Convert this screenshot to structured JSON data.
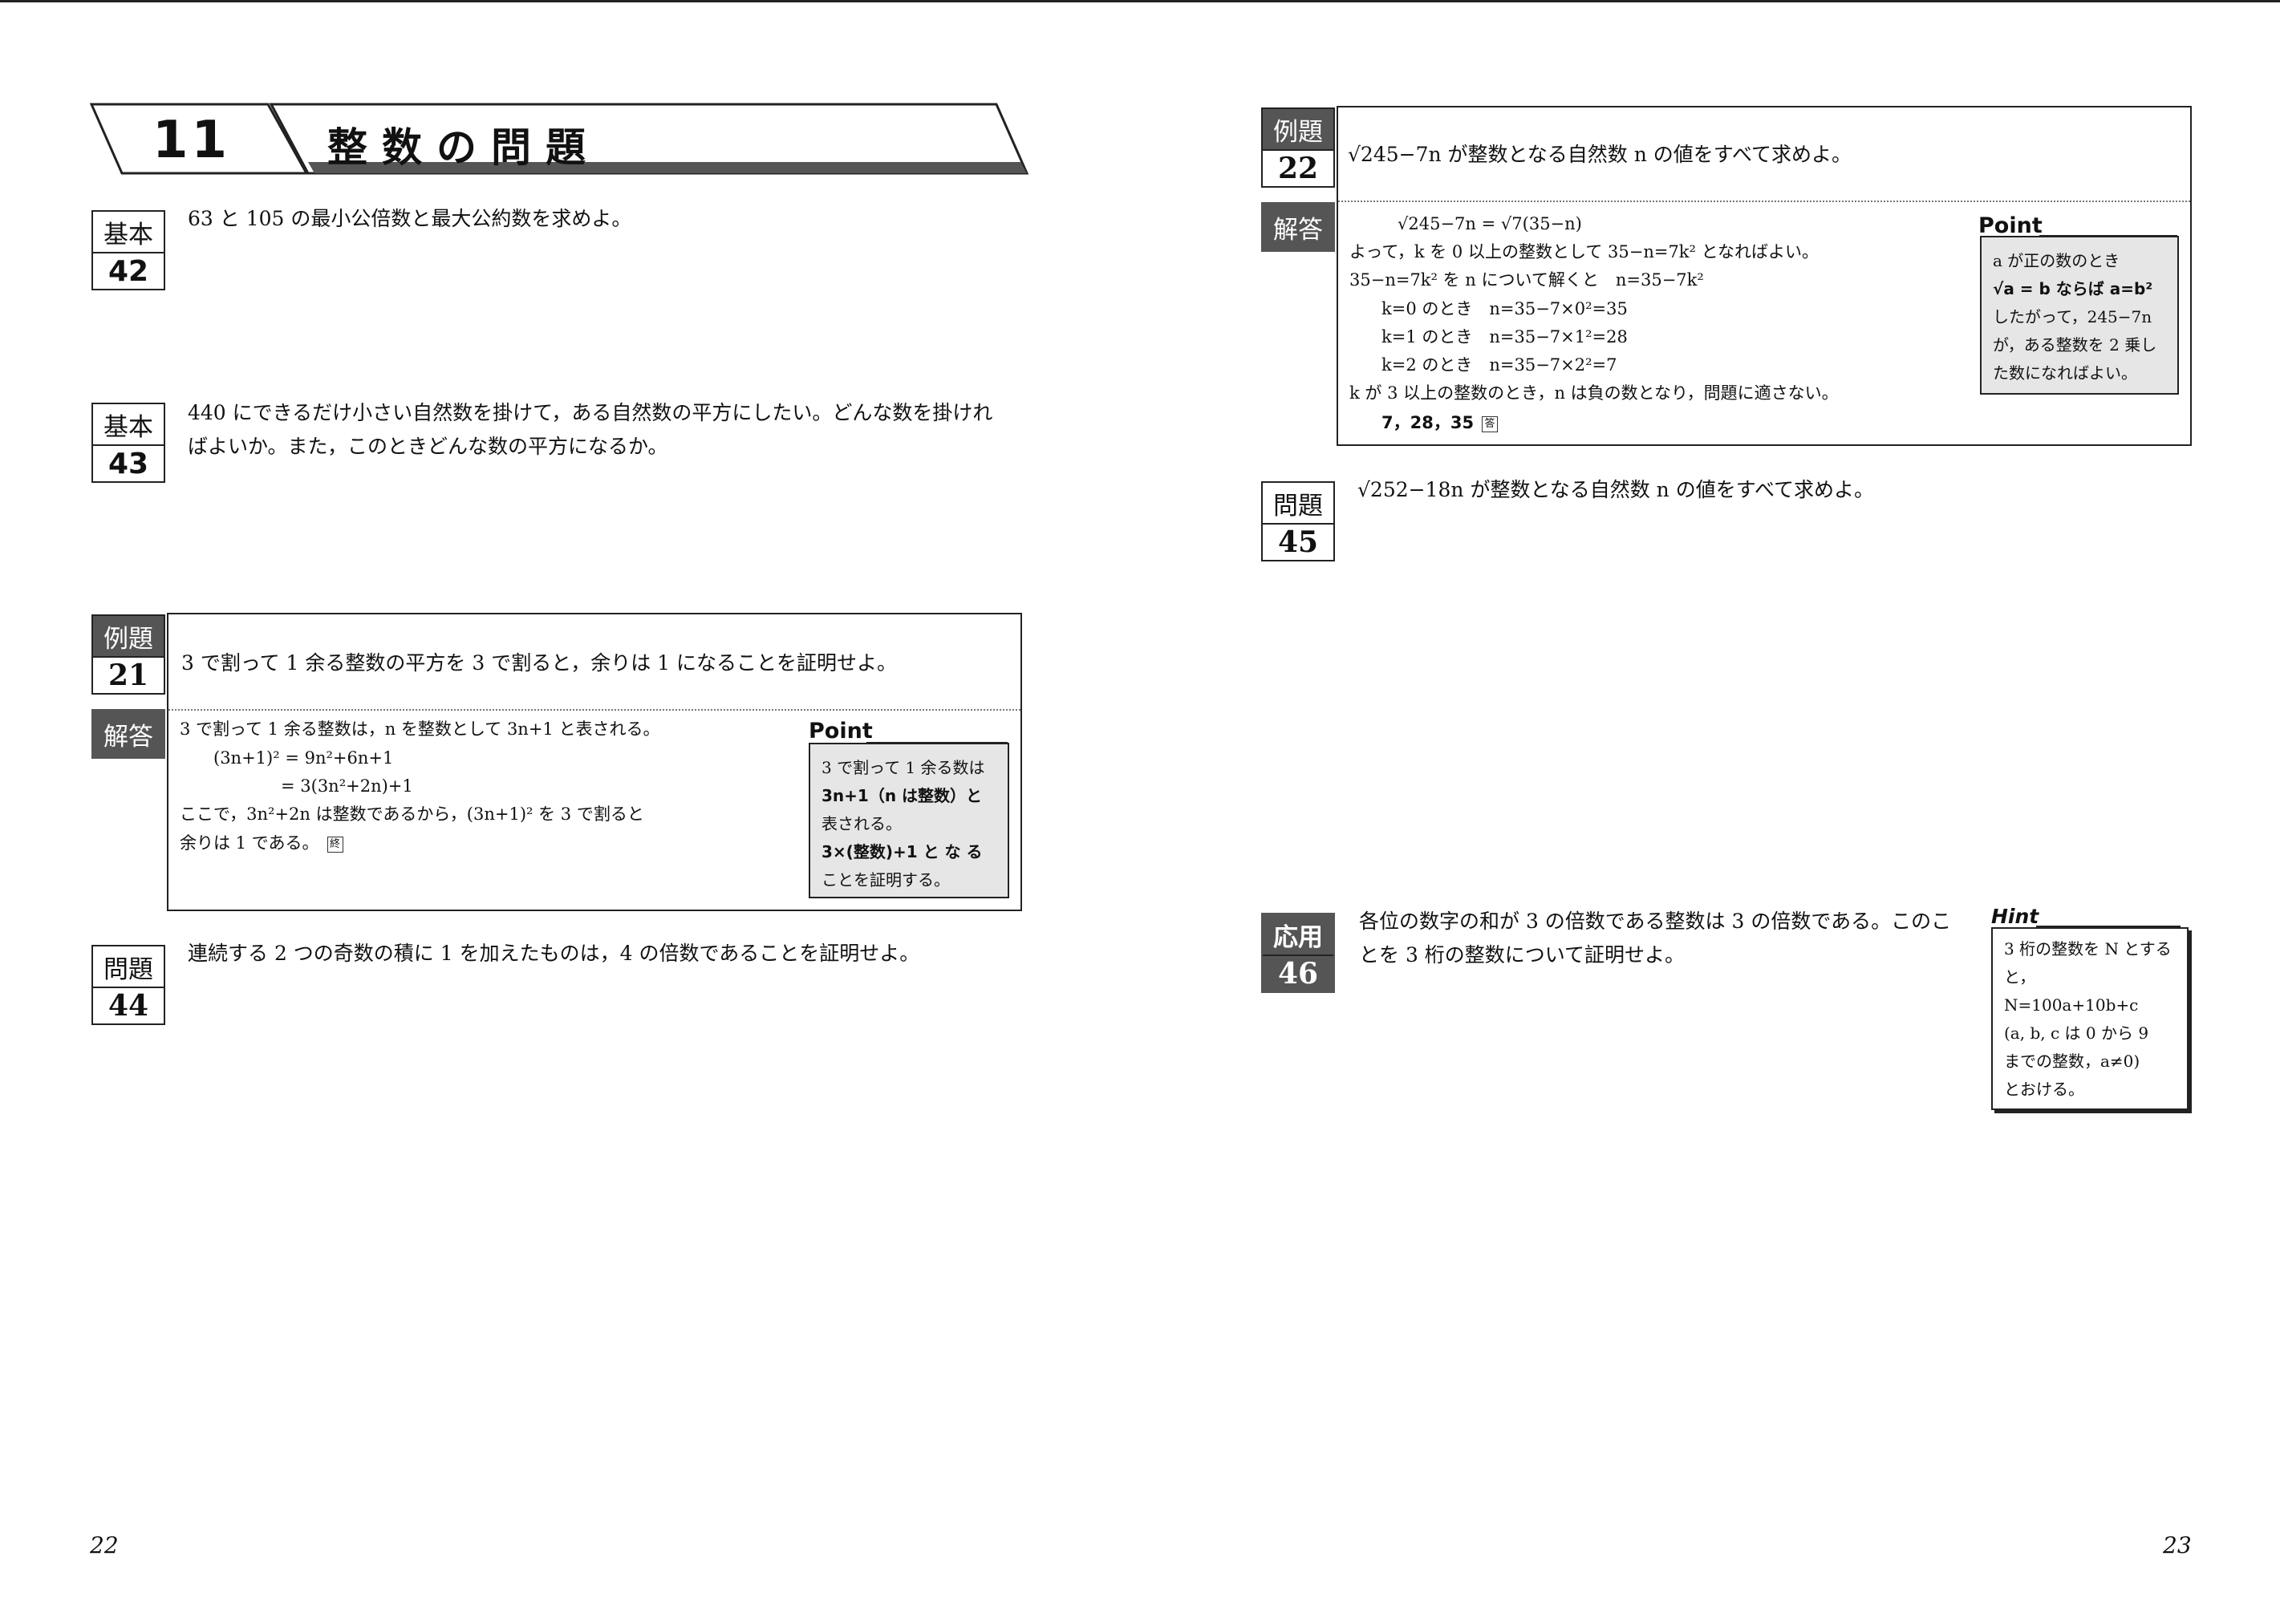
{
  "chapter": {
    "number": "11",
    "title": "整数の問題"
  },
  "left": {
    "k42": {
      "label": "基本",
      "num": "42",
      "text": "63 と 105 の最小公倍数と最大公約数を求めよ。"
    },
    "k43": {
      "label": "基本",
      "num": "43",
      "line1": "440 にできるだけ小さい自然数を掛けて，ある自然数の平方にしたい。どんな数を掛けれ",
      "line2": "ばよいか。また，このときどんな数の平方になるか。"
    },
    "ex21": {
      "label": "例題",
      "num": "21",
      "text": "3 で割って 1 余る整数の平方を 3 で割ると，余りは 1 になることを証明せよ。"
    },
    "ans21": {
      "label": "解答",
      "lines": [
        "3 で割って 1 余る整数は，n を整数として 3n+1 と表される。",
        "(3n+1)² = 9n²+6n+1",
        "= 3(3n²+2n)+1",
        "ここで，3n²+2n は整数であるから，(3n+1)² を 3 で割ると",
        "余りは 1 である。"
      ],
      "end_mark": "終"
    },
    "point21": {
      "title": "Point",
      "lines": [
        "3 で割って 1 余る数は",
        "3n+1（n は整数）と",
        "表される。",
        "3×(整数)+1 と な る",
        "ことを証明する。"
      ]
    },
    "p44": {
      "label": "問題",
      "num": "44",
      "text": "連続する 2 つの奇数の積に 1 を加えたものは，4 の倍数であることを証明せよ。"
    },
    "page_number": "22"
  },
  "right": {
    "ex22": {
      "label": "例題",
      "num": "22",
      "text": "√245−7n が整数となる自然数 n の値をすべて求めよ。"
    },
    "ans22": {
      "label": "解答",
      "lines": [
        "√245−7n = √7(35−n)",
        "よって，k を 0 以上の整数として 35−n=7k² となればよい。",
        "35−n=7k² を n について解くと　n=35−7k²",
        "k=0 のとき　n=35−7×0²=35",
        "k=1 のとき　n=35−7×1²=28",
        "k=2 のとき　n=35−7×2²=7",
        "k が 3 以上の整数のとき，n は負の数となり，問題に適さない。",
        "7，28，35"
      ],
      "end_mark": "答"
    },
    "point22": {
      "title": "Point",
      "lines": [
        "a が正の数のとき",
        "√a = b ならば a=b²",
        "したがって，245−7n",
        "が，ある整数を 2 乗し",
        "た数になればよい。"
      ]
    },
    "p45": {
      "label": "問題",
      "num": "45",
      "text": "√252−18n が整数となる自然数 n の値をすべて求めよ。"
    },
    "o46": {
      "label": "応用",
      "num": "46",
      "line1": "各位の数字の和が 3 の倍数である整数は 3 の倍数である。このこ",
      "line2": "とを 3 桁の整数について証明せよ。"
    },
    "hint46": {
      "title": "Hint",
      "lines": [
        "3 桁の整数を N とする",
        "と，",
        "N=100a+10b+c",
        "(a, b, c は 0 から 9",
        "までの整数，a≠0)",
        "とおける。"
      ]
    },
    "page_number": "23"
  }
}
